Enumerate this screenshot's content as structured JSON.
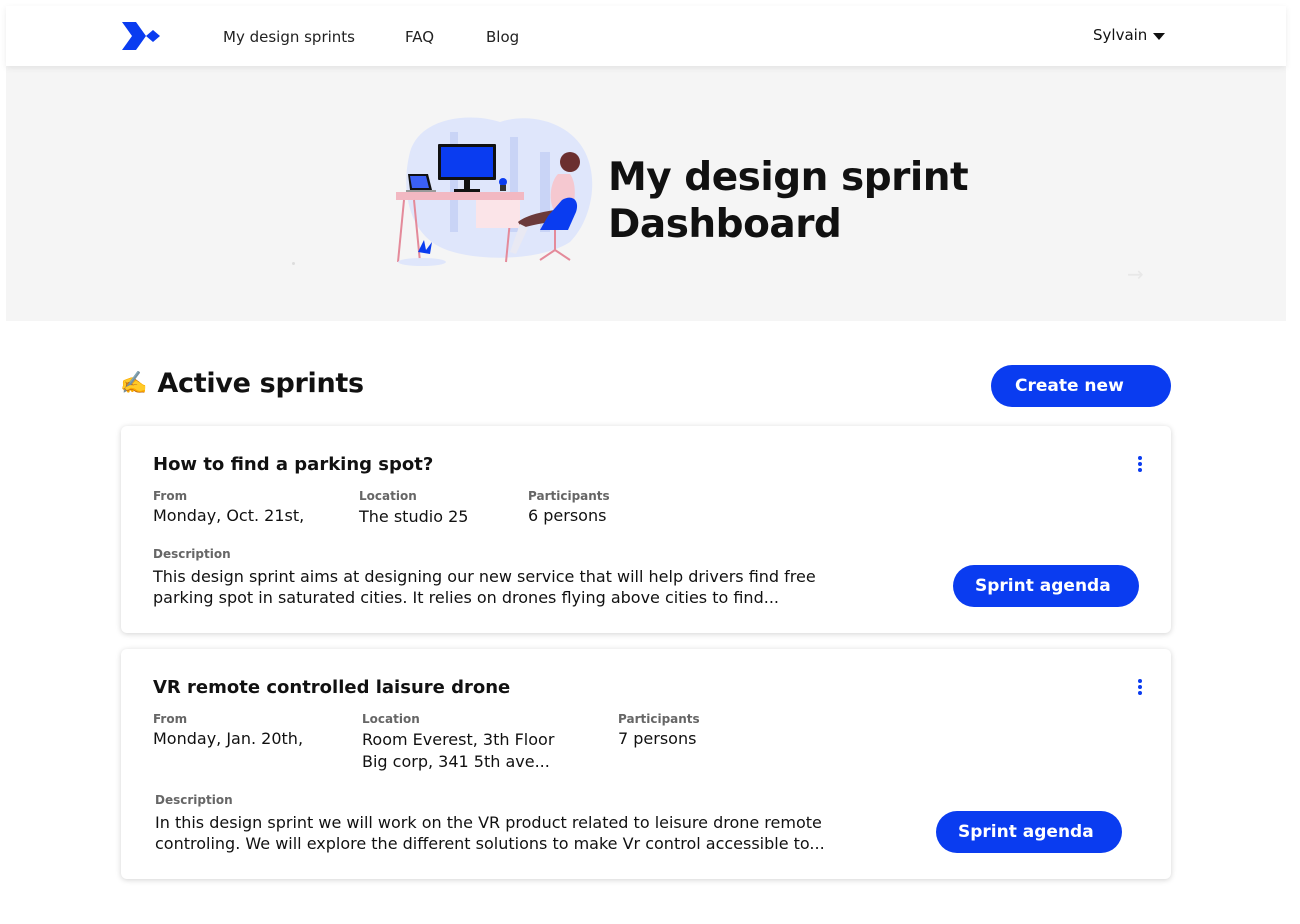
{
  "header": {
    "nav": [
      "My design sprints",
      "FAQ",
      "Blog"
    ],
    "user": "Sylvain"
  },
  "hero": {
    "title_line1": "My design sprint",
    "title_line2": "Dashboard",
    "arrow": "→"
  },
  "active": {
    "icon": "✍️",
    "title": "Active sprints",
    "create_label": "Create new"
  },
  "cards": [
    {
      "title": "How to find a parking spot?",
      "from_label": "From",
      "from_value": "Monday, Oct. 21st,",
      "location_label": "Location",
      "location_value_1": "The studio 25",
      "participants_label": "Participants",
      "participants_value": "6 persons",
      "description_label": "Description",
      "description_1": "This design sprint aims at designing our new service that will help drivers find free",
      "description_2": "parking spot in saturated cities. It relies on drones flying above cities to find...",
      "agenda_label": "Sprint agenda"
    },
    {
      "title": "VR remote controlled laisure drone",
      "from_label": "From",
      "from_value": "Monday, Jan. 20th,",
      "location_label": "Location",
      "location_value_1": "Room Everest, 3th Floor",
      "location_value_2": "Big corp, 341 5th ave...",
      "participants_label": "Participants",
      "participants_value": "7 persons",
      "description_label": "Description",
      "description_1": "In this design sprint we will work on the VR product related to leisure drone remote",
      "description_2": "controling. We will explore the different solutions to make Vr control accessible to...",
      "agenda_label": "Sprint agenda"
    }
  ],
  "colors": {
    "accent": "#0a3cf0",
    "hero_bg": "#f5f5f5"
  }
}
